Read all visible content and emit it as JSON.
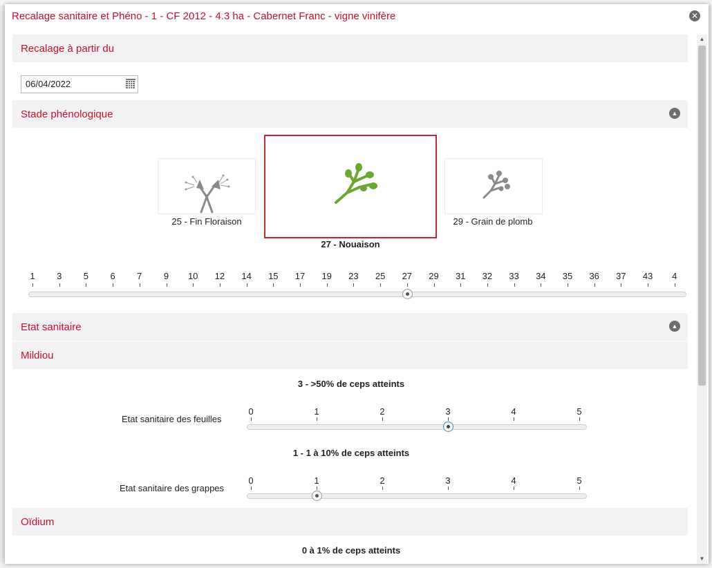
{
  "dialog": {
    "title": "Recalage sanitaire et Phéno - 1 - CF 2012 - 4.3 ha - Cabernet Franc - vigne vinifère",
    "close_icon": "close-icon"
  },
  "recalage": {
    "header": "Recalage à partir du",
    "date_value": "06/04/2022",
    "calendar_icon": "calendar-icon"
  },
  "phenology": {
    "header": "Stade phénologique",
    "collapse_icon": "chevron-up-icon",
    "cards": [
      {
        "label": "25 - Fin Floraison",
        "selected": false,
        "icon": "fin-floraison-icon"
      },
      {
        "label": "27 - Nouaison",
        "selected": true,
        "icon": "nouaison-icon"
      },
      {
        "label": "29 - Grain de plomb",
        "selected": false,
        "icon": "grain-de-plomb-icon"
      }
    ],
    "scale_ticks": [
      "1",
      "3",
      "5",
      "6",
      "7",
      "9",
      "10",
      "12",
      "14",
      "15",
      "17",
      "19",
      "23",
      "25",
      "27",
      "29",
      "31",
      "32",
      "33",
      "34",
      "35",
      "36",
      "37",
      "43",
      "4"
    ],
    "selected_value": "27"
  },
  "sanitaire": {
    "header": "Etat sanitaire",
    "collapse_icon": "chevron-up-icon",
    "mildiou": {
      "header": "Mildiou",
      "feuilles": {
        "status": "3 - >50% de ceps atteints",
        "label": "Etat sanitaire des feuilles",
        "value": 3
      },
      "grappes": {
        "status": "1 - 1 à 10% de ceps atteints",
        "label": "Etat sanitaire des grappes",
        "value": 1
      },
      "scale_ticks": [
        "0",
        "1",
        "2",
        "3",
        "4",
        "5"
      ]
    },
    "oidium": {
      "header": "Oïdium",
      "status": "0 à 1% de ceps atteints"
    }
  },
  "colors": {
    "accent_red": "#c8102e",
    "selected_border": "#c0282d",
    "plant_green": "#6aa832",
    "plant_grey": "#8a8a8a"
  }
}
